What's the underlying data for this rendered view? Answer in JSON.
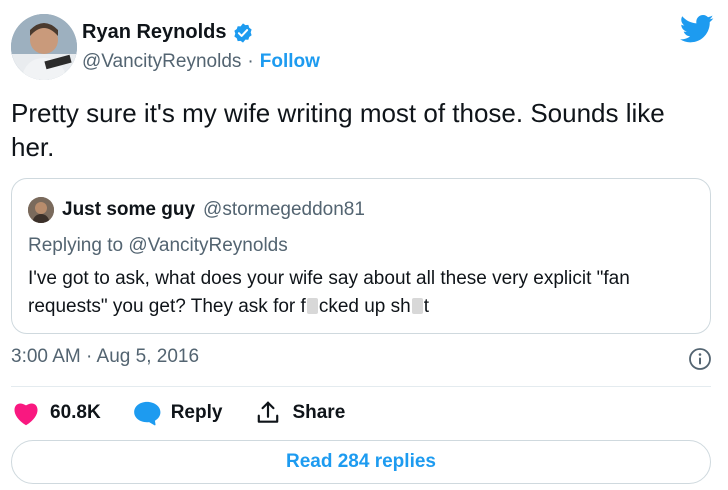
{
  "author": {
    "display_name": "Ryan Reynolds",
    "handle": "@VancityReynolds",
    "separator": "·",
    "follow_label": "Follow"
  },
  "tweet": {
    "text": "Pretty sure it's my wife writing most of those. Sounds like her."
  },
  "quoted": {
    "display_name": "Just some guy",
    "handle": "@stormegeddon81",
    "replying_to": "Replying to @VancityReynolds",
    "text_part1": "I've got to ask, what does your wife say about all these very explicit \"fan requests\" you get?  They ask for f",
    "text_part2": "cked up sh",
    "text_part3": "t"
  },
  "meta": {
    "timestamp": "3:00 AM · Aug 5, 2016"
  },
  "actions": {
    "like_count": "60.8K",
    "reply_label": "Reply",
    "share_label": "Share"
  },
  "read_replies_label": "Read 284 replies",
  "colors": {
    "brand_blue": "#1d9bf0",
    "like_pink": "#f91880",
    "secondary_text": "#536471",
    "border": "#cfd9de"
  },
  "icons": [
    "verified-badge-icon",
    "twitter-bird-icon",
    "info-icon",
    "heart-icon",
    "speech-bubble-icon",
    "share-upload-icon"
  ]
}
